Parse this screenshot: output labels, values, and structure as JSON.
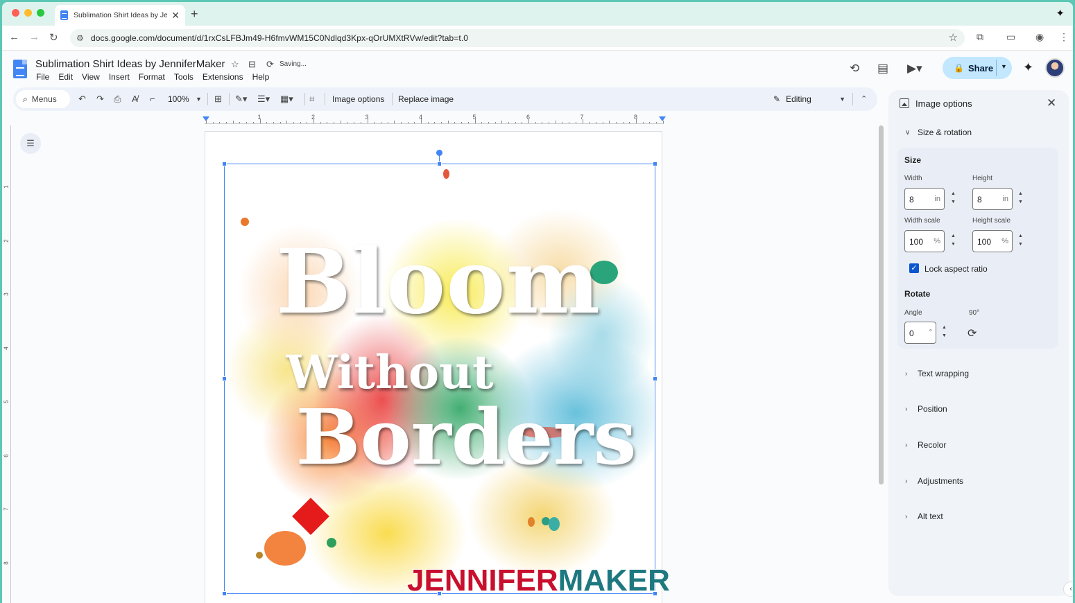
{
  "browser": {
    "tab_title": "Sublimation Shirt Ideas by JenniferMaker - Google Docs",
    "url": "docs.google.com/document/d/1rxCsLFBJm49-H6fmvWM15C0Ndlqd3Kpx-qOrUMXtRVw/edit?tab=t.0",
    "colors": {
      "frame": "#5cc7b4",
      "tab_strip": "#dff3ee"
    },
    "icons": [
      "back-icon",
      "forward-icon",
      "reload-icon",
      "bookmark-star-icon",
      "extensions-icon",
      "cast-icon",
      "profile-icon",
      "more-icon"
    ]
  },
  "docs": {
    "title": "Sublimation Shirt Ideas by JenniferMaker",
    "saving_status": "Saving...",
    "menus": [
      "File",
      "Edit",
      "View",
      "Insert",
      "Format",
      "Tools",
      "Extensions",
      "Help"
    ],
    "share_label": "Share",
    "colors": {
      "share_bg": "#c2e7ff",
      "accent": "#0b57d0",
      "selection": "#4285f4"
    }
  },
  "toolbar": {
    "menus_label": "Menus",
    "zoom": "100%",
    "image_options_label": "Image options",
    "replace_image_label": "Replace image",
    "mode_label": "Editing"
  },
  "ruler": {
    "numbers": [
      "1",
      "2",
      "3",
      "4",
      "5",
      "6",
      "7",
      "8"
    ]
  },
  "vruler": {
    "numbers": [
      "1",
      "2",
      "3",
      "4",
      "5",
      "6",
      "7",
      "8"
    ]
  },
  "image": {
    "line1": "Bloom",
    "line2": "Without",
    "line3": "Borders"
  },
  "watermark": {
    "part1": "JENNIFER",
    "part2": "MAKER"
  },
  "panel": {
    "title": "Image options",
    "size_rotation_label": "Size & rotation",
    "size_label": "Size",
    "width_label": "Width",
    "height_label": "Height",
    "width_value": "8",
    "height_value": "8",
    "length_unit": "in",
    "width_scale_label": "Width scale",
    "height_scale_label": "Height scale",
    "width_scale_value": "100",
    "height_scale_value": "100",
    "scale_unit": "%",
    "lock_aspect_label": "Lock aspect ratio",
    "lock_aspect_checked": true,
    "rotate_label": "Rotate",
    "angle_label": "Angle",
    "angle_value": "0",
    "angle_unit": "°",
    "rotate90_label": "90°",
    "sections": [
      "Text wrapping",
      "Position",
      "Recolor",
      "Adjustments",
      "Alt text"
    ]
  }
}
